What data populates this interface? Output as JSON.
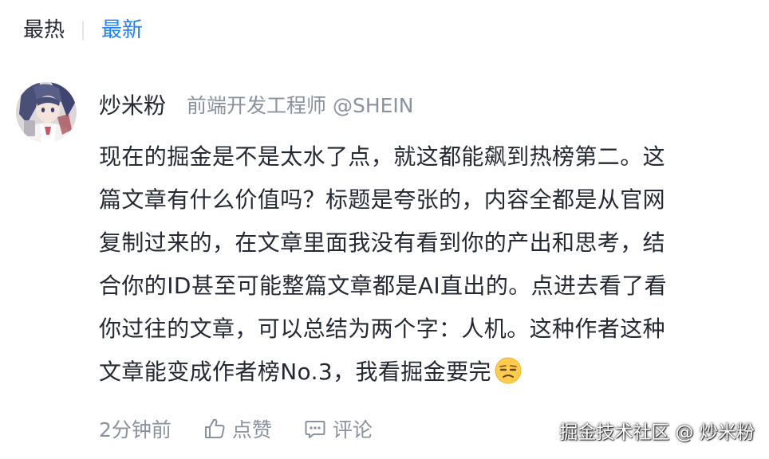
{
  "sort": {
    "hot_label": "最热",
    "new_label": "最新",
    "active": "最新",
    "active_color": "#1e80ff"
  },
  "comment": {
    "avatar_icon": "anime-avatar",
    "username": "炒米粉",
    "user_title": "前端开发工程师 @SHEIN",
    "content_lines": [
      "现在的掘金是不是太水了点，就这都能飙到热榜第二。这",
      "篇文章有什么价值吗？标题是夸张的，内容全都是从官网",
      "复制过来的，在文章里面我没有看到你的产出和思考，结",
      "合你的ID甚至可能整篇文章都是AI直出的。点进去看了看",
      "你过往的文章，可以总结为两个字：人机。这种作者这种",
      "文章能变成作者榜No.3，我看掘金要完"
    ],
    "emoji_icon": "unamused-face-emoji",
    "time": "2分钟前",
    "like_icon": "thumbs-up-icon",
    "like_label": "点赞",
    "reply_icon": "comment-icon",
    "reply_label": "评论"
  },
  "watermark": "掘金技术社区 @ 炒米粉"
}
